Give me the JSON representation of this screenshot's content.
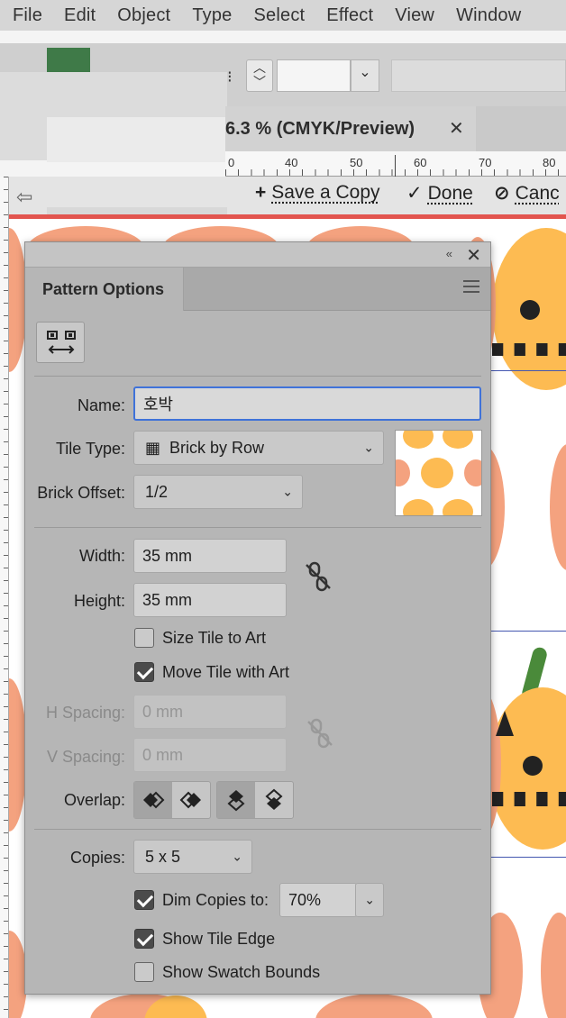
{
  "menu": [
    "File",
    "Edit",
    "Object",
    "Type",
    "Select",
    "Effect",
    "View",
    "Window"
  ],
  "document": {
    "tab_title": "6.3 % (CMYK/Preview)",
    "close_glyph": "✕"
  },
  "ruler": {
    "labels": [
      "0",
      "40",
      "50",
      "60",
      "70",
      "80"
    ]
  },
  "isolation": {
    "back_glyph": "⇦",
    "save_copy": "Save a Copy",
    "done": "Done",
    "cancel": "Canc",
    "save_icon": "+",
    "done_icon": "✓",
    "cancel_icon": "⊘"
  },
  "colors": {
    "accent": "#3f72d9",
    "isolation_line": "#e2544e",
    "pumpkin_orange": "#f4a27f",
    "pumpkin_yellow": "#fdbb52",
    "tile_edge": "#4457b0"
  },
  "panel": {
    "title": "Pattern Options",
    "collapse_glyph": "«",
    "close_glyph": "✕",
    "name_label": "Name:",
    "name_value": "호박",
    "tile_type_label": "Tile Type:",
    "tile_type_value": "Brick by Row",
    "tile_type_icon": "▦",
    "brick_offset_label": "Brick Offset:",
    "brick_offset_value": "1/2",
    "width_label": "Width:",
    "width_value": "35 mm",
    "height_label": "Height:",
    "height_value": "35 mm",
    "size_tile_label": "Size Tile to Art",
    "size_tile_checked": false,
    "move_tile_label": "Move Tile with Art",
    "move_tile_checked": true,
    "h_spacing_label": "H Spacing:",
    "h_spacing_value": "0 mm",
    "v_spacing_label": "V Spacing:",
    "v_spacing_value": "0 mm",
    "overlap_label": "Overlap:",
    "copies_label": "Copies:",
    "copies_value": "5 x 5",
    "dim_copies_label": "Dim Copies to:",
    "dim_copies_value": "70%",
    "dim_copies_checked": true,
    "show_tile_edge_label": "Show Tile Edge",
    "show_tile_edge_checked": true,
    "show_swatch_bounds_label": "Show Swatch Bounds",
    "show_swatch_bounds_checked": false,
    "chevron": "⌄"
  }
}
